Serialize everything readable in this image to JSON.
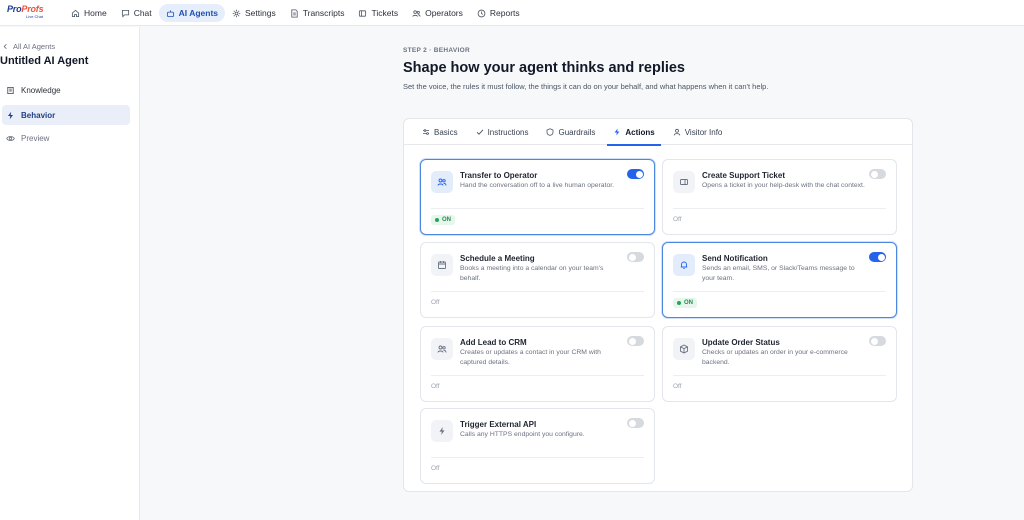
{
  "brand": {
    "name_a": "Pro",
    "name_b": "Profs",
    "sub": "Live Chat"
  },
  "nav": {
    "home": "Home",
    "chat": "Chat",
    "ai_agents": "AI Agents",
    "settings": "Settings",
    "transcripts": "Transcripts",
    "tickets": "Tickets",
    "operators": "Operators",
    "reports": "Reports"
  },
  "sidebar": {
    "back": "All AI Agents",
    "agent_name": "Untitled AI Agent",
    "knowledge": "Knowledge",
    "behavior": "Behavior",
    "preview": "Preview"
  },
  "header": {
    "step": "STEP 2 · BEHAVIOR",
    "title": "Shape how your agent thinks and replies",
    "subtitle": "Set the voice, the rules it must follow, the things it can do on your behalf, and what happens when it can't help."
  },
  "tabs": {
    "basics": "Basics",
    "instructions": "Instructions",
    "guardrails": "Guardrails",
    "actions": "Actions",
    "visitor_info": "Visitor Info"
  },
  "status": {
    "on": "ON",
    "off": "Off"
  },
  "actions": {
    "transfer": {
      "title": "Transfer to Operator",
      "desc": "Hand the conversation off to a live human operator."
    },
    "ticket": {
      "title": "Create Support Ticket",
      "desc": "Opens a ticket in your help-desk with the chat context."
    },
    "meeting": {
      "title": "Schedule a Meeting",
      "desc": "Books a meeting into a calendar on your team's behalf."
    },
    "notification": {
      "title": "Send Notification",
      "desc": "Sends an email, SMS, or Slack/Teams message to your team."
    },
    "crm": {
      "title": "Add Lead to CRM",
      "desc": "Creates or updates a contact in your CRM with captured details."
    },
    "order": {
      "title": "Update Order Status",
      "desc": "Checks or updates an order in your e-commerce backend."
    },
    "api": {
      "title": "Trigger External API",
      "desc": "Calls any HTTPS endpoint you configure."
    }
  },
  "colors": {
    "accent": "#2563eb",
    "active_nav_bg": "#e6eefb",
    "on_badge": "#1e8c4a"
  }
}
